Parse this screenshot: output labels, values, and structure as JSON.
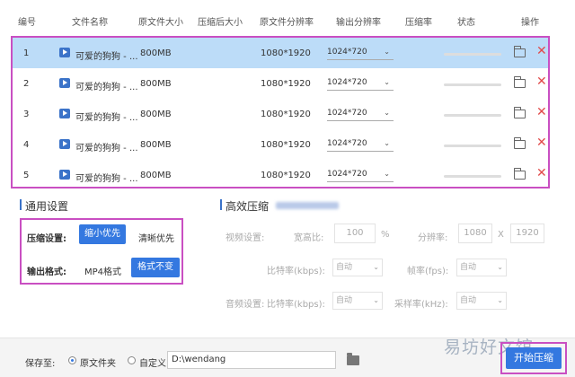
{
  "table": {
    "headers": {
      "index": "编号",
      "file_name": "文件名称",
      "orig_size": "原文件大小",
      "comp_size": "压缩后大小",
      "orig_res": "原文件分辨率",
      "out_res": "输出分辨率",
      "ratio": "压缩率",
      "status": "状态",
      "action": "操作"
    },
    "rows": [
      {
        "index": "1",
        "name": "可爱的狗狗 - ...",
        "size": "800MB",
        "orig_res": "1080*1920",
        "out_res": "1024*720"
      },
      {
        "index": "2",
        "name": "可爱的狗狗 - ...",
        "size": "800MB",
        "orig_res": "1080*1920",
        "out_res": "1024*720"
      },
      {
        "index": "3",
        "name": "可爱的狗狗 - ...",
        "size": "800MB",
        "orig_res": "1080*1920",
        "out_res": "1024*720"
      },
      {
        "index": "4",
        "name": "可爱的狗狗 - ...",
        "size": "800MB",
        "orig_res": "1080*1920",
        "out_res": "1024*720"
      },
      {
        "index": "5",
        "name": "可爱的狗狗 - ...",
        "size": "800MB",
        "orig_res": "1080*1920",
        "out_res": "1024*720"
      }
    ]
  },
  "general": {
    "title": "通用设置",
    "compress_label": "压缩设置:",
    "compress_small": "缩小优先",
    "compress_clear": "清晰优先",
    "format_label": "输出格式:",
    "format_value": "MP4格式",
    "format_unchanged": "格式不变"
  },
  "efficient": {
    "title": "高效压缩",
    "video_settings": "视频设置:",
    "aspect_label": "宽高比:",
    "aspect_value": "100",
    "percent": "%",
    "resolution_label": "分辨率:",
    "res_w": "1080",
    "res_x": "X",
    "res_h": "1920",
    "bitrate_label": "比特率(kbps):",
    "bitrate_value": "自动",
    "fps_label": "帧率(fps):",
    "fps_value": "自动",
    "audio_settings": "音频设置:",
    "audio_bitrate_label": "比特率(kbps):",
    "audio_bitrate_value": "自动",
    "sample_label": "采样率(kHz):",
    "sample_value": "自动"
  },
  "footer": {
    "save_to": "保存至:",
    "option_original": "原文件夹",
    "option_custom": "自定义",
    "path": "D:\\wendang",
    "start": "开始压缩"
  },
  "watermark": "易坊好文馆",
  "colors": {
    "accent": "#3478e0",
    "highlight_border": "#c94fc2",
    "selected_row": "#bcdcf8",
    "delete": "#e14b4b"
  }
}
